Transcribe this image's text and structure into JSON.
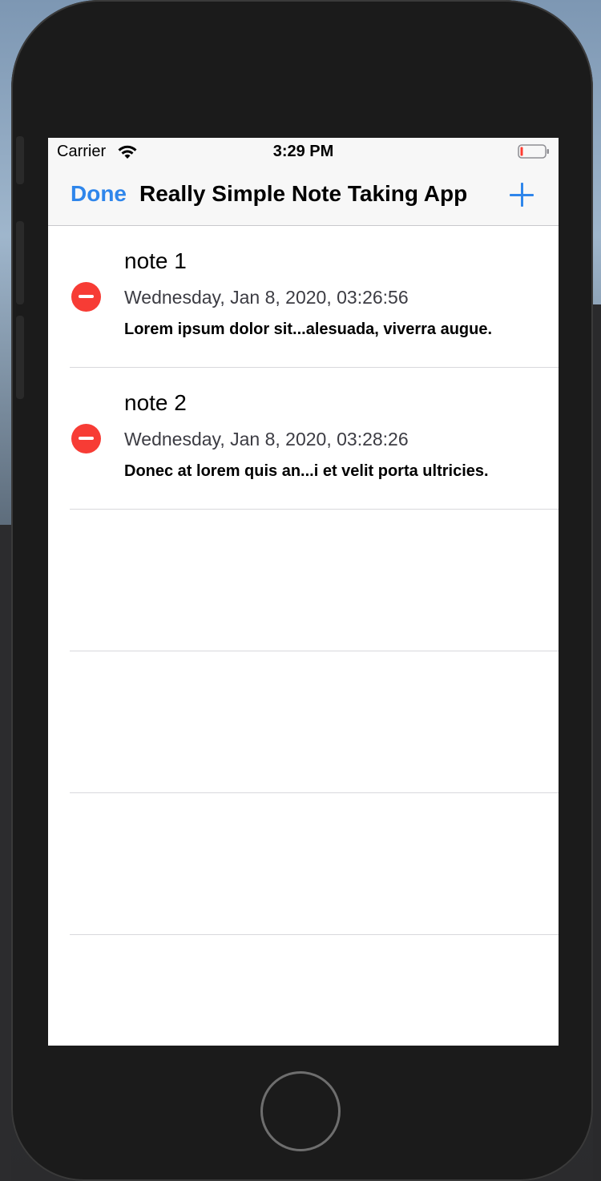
{
  "status_bar": {
    "carrier": "Carrier",
    "time": "3:29 PM",
    "wifi_icon": "wifi-icon",
    "battery_icon": "battery-icon"
  },
  "nav": {
    "left_button": "Done",
    "title": "Really Simple Note Taking App",
    "right_icon": "plus-icon"
  },
  "notes": [
    {
      "title": "note 1",
      "date": "Wednesday, Jan 8, 2020, 03:26:56",
      "preview": "Lorem ipsum dolor sit...alesuada, viverra augue."
    },
    {
      "title": "note 2",
      "date": "Wednesday, Jan 8, 2020, 03:28:26",
      "preview": "Donec at lorem quis an...i et velit porta ultricies."
    }
  ],
  "colors": {
    "accent": "#2f86eb",
    "delete": "#f73c35",
    "device": "#1b1b1b"
  }
}
